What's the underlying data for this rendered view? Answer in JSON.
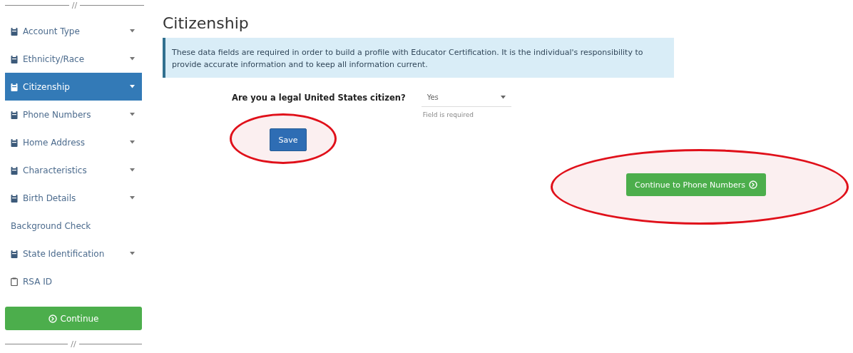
{
  "sidebar": {
    "top_divider": "//",
    "items": [
      {
        "label": "Account Type",
        "kind": "form",
        "selected": false,
        "has_caret": true
      },
      {
        "label": "Ethnicity/Race",
        "kind": "form",
        "selected": false,
        "has_caret": true
      },
      {
        "label": "Citizenship",
        "kind": "form",
        "selected": true,
        "has_caret": true
      },
      {
        "label": "Phone Numbers",
        "kind": "form",
        "selected": false,
        "has_caret": true
      },
      {
        "label": "Home Address",
        "kind": "form",
        "selected": false,
        "has_caret": true
      },
      {
        "label": "Characteristics",
        "kind": "form",
        "selected": false,
        "has_caret": true
      },
      {
        "label": "Birth Details",
        "kind": "form",
        "selected": false,
        "has_caret": true
      },
      {
        "label": "Background Check",
        "kind": "plain",
        "selected": false,
        "has_caret": false
      },
      {
        "label": "State Identification",
        "kind": "form",
        "selected": false,
        "has_caret": true
      },
      {
        "label": "RSA ID",
        "kind": "empty",
        "selected": false,
        "has_caret": false
      }
    ],
    "continue_button": {
      "label": "Continue"
    },
    "bottom_divider": "//"
  },
  "main": {
    "title": "Citizenship",
    "alert": "These data fields are required in order to build a profile with Educator Certification. It is the individual's responsibility to provide accurate information and to keep all information current.",
    "question": {
      "label": "Are you a legal United States citizen?",
      "value": "Yes",
      "hint": "Field is required"
    },
    "save_button": {
      "label": "Save",
      "highlighted": true
    },
    "next_button": {
      "label": "Continue to Phone Numbers",
      "highlighted": true
    }
  }
}
